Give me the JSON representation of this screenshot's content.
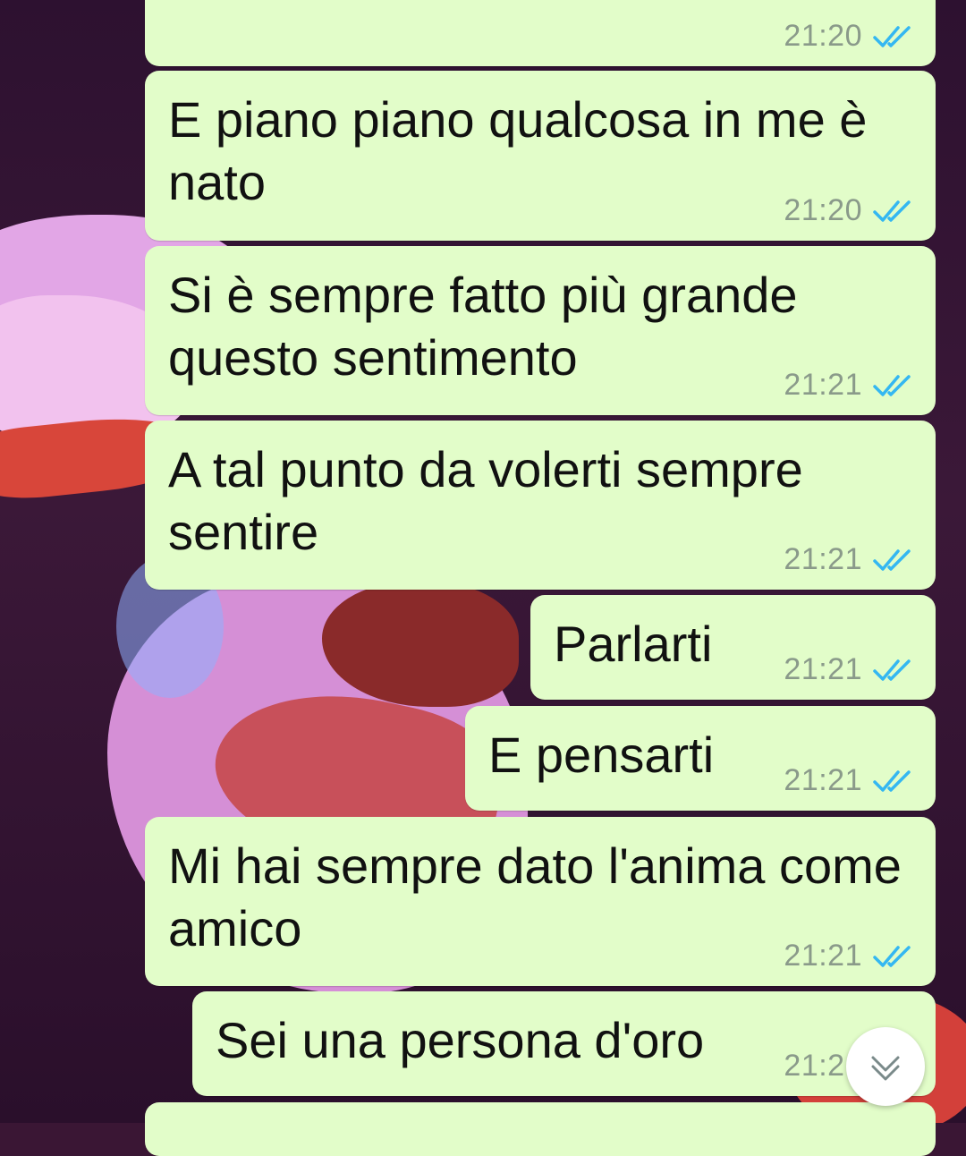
{
  "colors": {
    "outgoing_bubble": "#e2fdc9",
    "timestamp": "#8a9a8a",
    "read_ticks": "#34b7f1"
  },
  "messages": [
    {
      "text": "",
      "time": "21:20",
      "status": "read",
      "status_icon": "double-check-icon"
    },
    {
      "text": "E piano piano qualcosa in me è nato",
      "time": "21:20",
      "status": "read",
      "status_icon": "double-check-icon"
    },
    {
      "text": "Si è sempre fatto più grande questo sentimento",
      "time": "21:21",
      "status": "read",
      "status_icon": "double-check-icon"
    },
    {
      "text": "A tal punto da volerti sempre sentire",
      "time": "21:21",
      "status": "read",
      "status_icon": "double-check-icon"
    },
    {
      "text": "Parlarti",
      "time": "21:21",
      "status": "read",
      "status_icon": "double-check-icon"
    },
    {
      "text": "E pensarti",
      "time": "21:21",
      "status": "read",
      "status_icon": "double-check-icon"
    },
    {
      "text": "Mi hai sempre dato l'anima come amico",
      "time": "21:21",
      "status": "read",
      "status_icon": "double-check-icon"
    },
    {
      "text": "Sei una persona d'oro",
      "time": "21:21",
      "status": "read",
      "status_icon": "double-check-icon"
    }
  ],
  "scroll_button": {
    "icon": "chevron-down-icon"
  }
}
